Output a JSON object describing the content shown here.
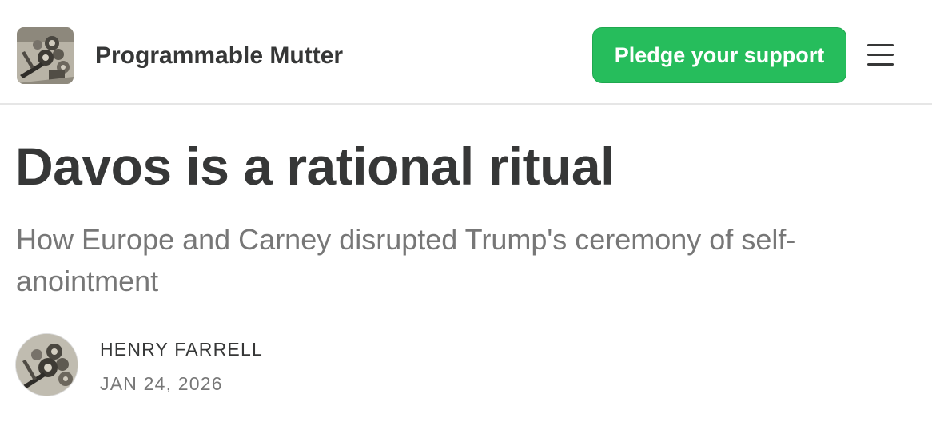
{
  "header": {
    "publication_name": "Programmable Mutter",
    "pledge_label": "Pledge your support",
    "logo_icon": "publication-logo-engraving",
    "menu_icon": "hamburger-menu-icon",
    "accent_color": "#26bd5c"
  },
  "post": {
    "title": "Davos is a rational ritual",
    "subtitle": "How Europe and Carney disrupted Trump's ceremony of self-anointment",
    "author": "HENRY FARRELL",
    "date": "JAN 24, 2026"
  }
}
